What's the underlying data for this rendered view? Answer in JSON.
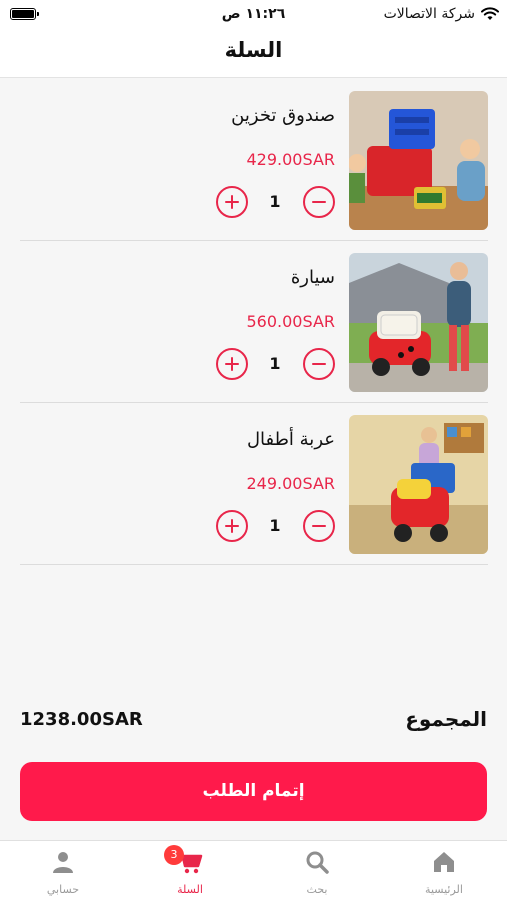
{
  "status_bar": {
    "carrier": "شركة الاتصالات",
    "time": "١١:٢٦ ص"
  },
  "header": {
    "title": "السلة"
  },
  "cart": {
    "items": [
      {
        "name": "صندوق تخزين",
        "price": "429.00SAR",
        "quantity": "1",
        "image": "storage-box-photo"
      },
      {
        "name": "سيارة",
        "price": "560.00SAR",
        "quantity": "1",
        "image": "ride-on-car-photo"
      },
      {
        "name": "عربة أطفال",
        "price": "249.00SAR",
        "quantity": "1",
        "image": "shopping-cart-toy-photo"
      }
    ]
  },
  "summary": {
    "total_label": "المجموع",
    "total_value": "1238.00SAR"
  },
  "checkout": {
    "label": "إتمام الطلب"
  },
  "tabs": [
    {
      "label": "الرئيسية",
      "icon": "home-icon"
    },
    {
      "label": "بحث",
      "icon": "search-icon"
    },
    {
      "label": "السلة",
      "icon": "cart-icon",
      "badge": "3"
    },
    {
      "label": "حسابي",
      "icon": "person-icon"
    }
  ],
  "colors": {
    "accent": "#e8264a",
    "button": "#ff1a4b",
    "badge": "#ff3b3b"
  }
}
